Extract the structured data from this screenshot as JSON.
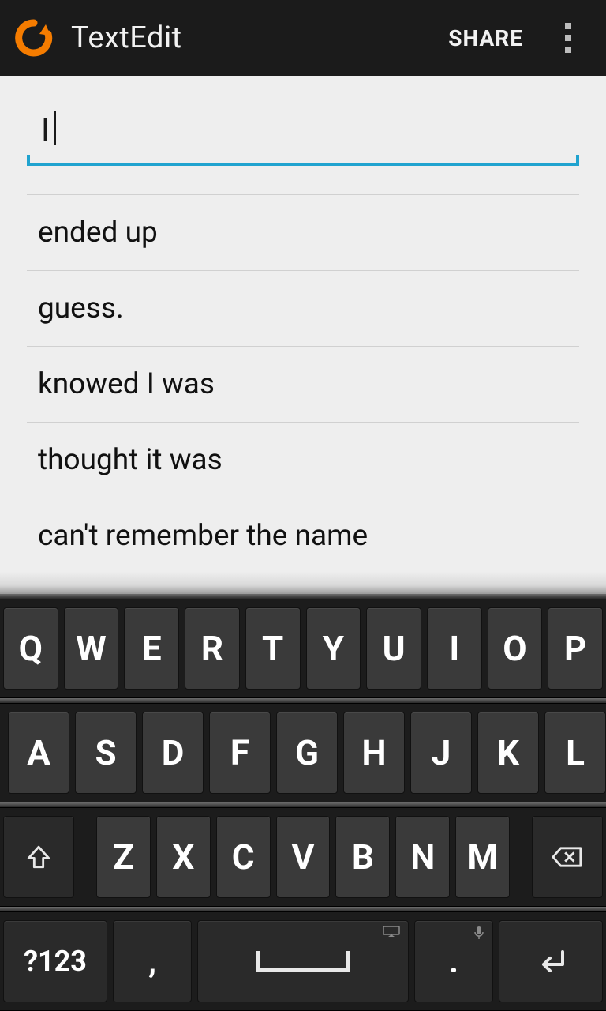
{
  "header": {
    "title": "TextEdit",
    "share_label": "SHARE"
  },
  "input": {
    "value": "I"
  },
  "suggestions": [
    "ended up",
    "guess.",
    "knowed I was",
    "thought it was",
    "can't remember the name"
  ],
  "keyboard": {
    "row1": [
      "Q",
      "W",
      "E",
      "R",
      "T",
      "Y",
      "U",
      "I",
      "O",
      "P"
    ],
    "row2": [
      "A",
      "S",
      "D",
      "F",
      "G",
      "H",
      "J",
      "K",
      "L"
    ],
    "row3": [
      "Z",
      "X",
      "C",
      "V",
      "B",
      "N",
      "M"
    ],
    "sym_label": "?123",
    "comma_label": ",",
    "period_label": "."
  }
}
